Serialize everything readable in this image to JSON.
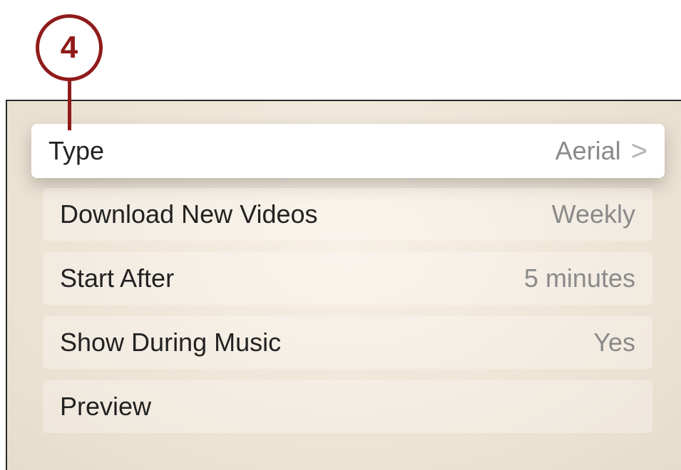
{
  "callout": {
    "number": "4"
  },
  "settings": {
    "rows": [
      {
        "label": "Type",
        "value": "Aerial",
        "chevron": "›"
      },
      {
        "label": "Download New Videos",
        "value": "Weekly"
      },
      {
        "label": "Start After",
        "value": "5 minutes"
      },
      {
        "label": "Show During Music",
        "value": "Yes"
      },
      {
        "label": "Preview"
      }
    ]
  },
  "colors": {
    "callout": "#8f1b1b",
    "focused_row": "#ffffff",
    "background": "#f1e8db"
  }
}
